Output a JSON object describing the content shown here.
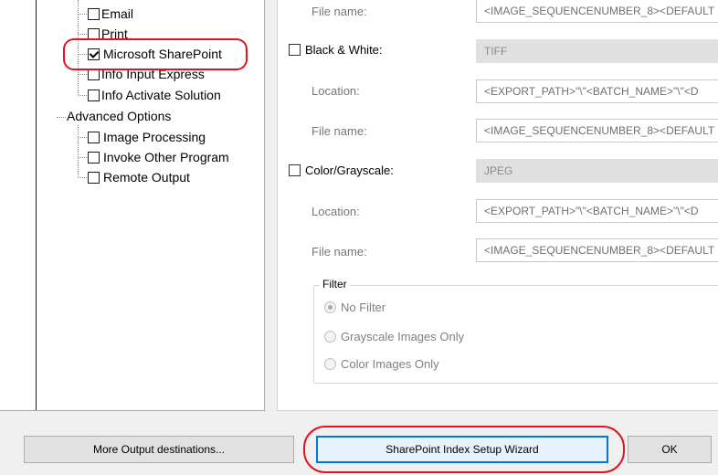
{
  "tree": {
    "items": [
      {
        "label": "Email",
        "checked": false
      },
      {
        "label": "Print",
        "checked": false
      },
      {
        "label": "Microsoft SharePoint",
        "checked": true
      },
      {
        "label": "Info Input Express",
        "checked": false
      },
      {
        "label": "Info Activate Solution",
        "checked": false
      }
    ],
    "advanced_options": {
      "label": "Advanced Options",
      "items": [
        {
          "label": "Image Processing",
          "checked": false
        },
        {
          "label": "Invoke Other Program",
          "checked": false
        },
        {
          "label": "Remote Output",
          "checked": false
        }
      ]
    }
  },
  "settings": {
    "top_file_name": {
      "label": "File name:",
      "value": "<IMAGE_SEQUENCENUMBER_8><DEFAULT"
    },
    "black_white": {
      "label": "Black & White:",
      "checked": false,
      "format": "TIFF",
      "location_label": "Location:",
      "location_value": "<EXPORT_PATH>\"\\\"<BATCH_NAME>\"\\\"<D",
      "file_name_label": "File name:",
      "file_name_value": "<IMAGE_SEQUENCENUMBER_8><DEFAULT"
    },
    "color_grayscale": {
      "label": "Color/Grayscale:",
      "checked": false,
      "format": "JPEG",
      "location_label": "Location:",
      "location_value": "<EXPORT_PATH>\"\\\"<BATCH_NAME>\"\\\"<D",
      "file_name_label": "File name:",
      "file_name_value": "<IMAGE_SEQUENCENUMBER_8><DEFAULT"
    },
    "filter": {
      "title": "Filter",
      "options": [
        {
          "label": "No Filter",
          "selected": true
        },
        {
          "label": "Grayscale Images Only",
          "selected": false
        },
        {
          "label": "Color Images Only",
          "selected": false
        }
      ]
    }
  },
  "buttons": {
    "more_output": "More Output destinations...",
    "sharepoint_wizard": "SharePoint Index Setup Wizard",
    "ok": "OK"
  },
  "colors": {
    "highlight": "#e0141e",
    "focus": "#0078d7"
  }
}
